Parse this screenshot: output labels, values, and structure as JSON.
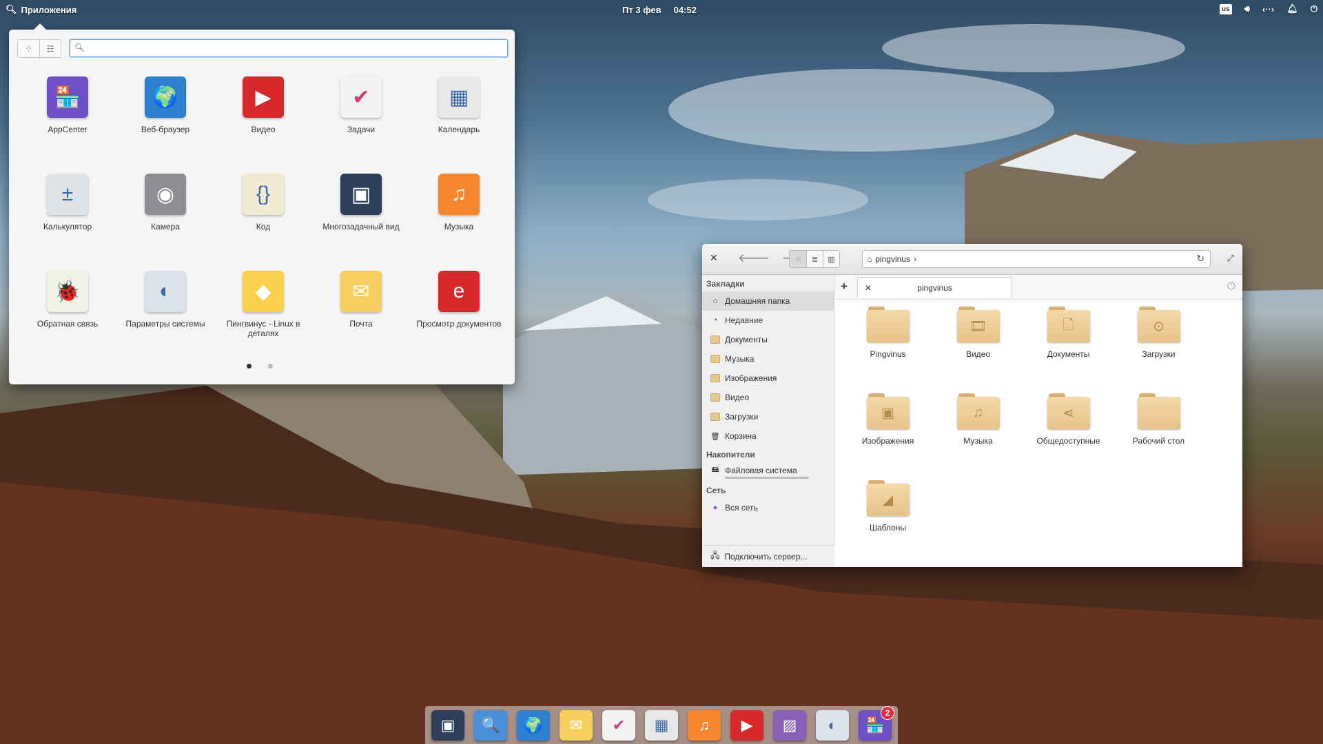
{
  "panel": {
    "apps_label": "Приложения",
    "date": "Пт  3 фев",
    "time": "04:52",
    "keyboard_layout": "us",
    "network": "‹··›"
  },
  "launcher": {
    "search_value": "",
    "apps": [
      {
        "label": "AppCenter",
        "icon": "appcenter-icon",
        "color": "#6f4fc7",
        "glyph": "🏪"
      },
      {
        "label": "Веб-браузер",
        "icon": "browser-icon",
        "color": "#2d7fd0",
        "glyph": "🌍"
      },
      {
        "label": "Видео",
        "icon": "video-icon",
        "color": "#d7282b",
        "glyph": "▶"
      },
      {
        "label": "Задачи",
        "icon": "tasks-icon",
        "color": "#f2f2f2",
        "glyph": "✔"
      },
      {
        "label": "Календарь",
        "icon": "calendar-icon",
        "color": "#e8e8e8",
        "glyph": "▦"
      },
      {
        "label": "Калькулятор",
        "icon": "calculator-icon",
        "color": "#dfe3e6",
        "glyph": "±"
      },
      {
        "label": "Камера",
        "icon": "camera-icon",
        "color": "#8d8f93",
        "glyph": "◉"
      },
      {
        "label": "Код",
        "icon": "code-icon",
        "color": "#f2ebd3",
        "glyph": "{}"
      },
      {
        "label": "Многозадачный вид",
        "icon": "multitasking-icon",
        "color": "#2c3e59",
        "glyph": "▣"
      },
      {
        "label": "Музыка",
        "icon": "music-icon",
        "color": "#f5862d",
        "glyph": "♫"
      },
      {
        "label": "Обратная связь",
        "icon": "feedback-icon",
        "color": "#eef3e6",
        "glyph": "🐞"
      },
      {
        "label": "Параметры системы",
        "icon": "settings-icon",
        "color": "#dde3ea",
        "glyph": "◐"
      },
      {
        "label": "Пингвинус - Linux в деталях",
        "icon": "pingvinus-icon",
        "color": "#fbd04b",
        "glyph": "◆"
      },
      {
        "label": "Почта",
        "icon": "mail-icon",
        "color": "#f6cf5c",
        "glyph": "✉"
      },
      {
        "label": "Просмотр документов",
        "icon": "document-viewer-icon",
        "color": "#d7282b",
        "glyph": "e"
      }
    ],
    "page": 1,
    "pages": 2
  },
  "files": {
    "path": "pingvinus",
    "tab_label": "pingvinus",
    "sections": {
      "bookmarks": "Закладки",
      "devices": "Накопители",
      "network": "Сеть"
    },
    "bookmarks": [
      {
        "label": "Домашняя папка",
        "icon": "home-icon"
      },
      {
        "label": "Недавние",
        "icon": "recent-icon"
      },
      {
        "label": "Документы",
        "icon": "folder-icon"
      },
      {
        "label": "Музыка",
        "icon": "folder-icon"
      },
      {
        "label": "Изображения",
        "icon": "folder-icon"
      },
      {
        "label": "Видео",
        "icon": "folder-icon"
      },
      {
        "label": "Загрузки",
        "icon": "folder-icon"
      },
      {
        "label": "Корзина",
        "icon": "trash-icon"
      }
    ],
    "devices": [
      {
        "label": "Файловая система",
        "icon": "drive-icon"
      }
    ],
    "network_items": [
      {
        "label": "Вся сеть",
        "icon": "network-icon"
      }
    ],
    "connect_label": "Подключить сервер...",
    "folders": [
      {
        "label": "Pingvinus",
        "glyph": ""
      },
      {
        "label": "Видео",
        "glyph": "🎞"
      },
      {
        "label": "Документы",
        "glyph": "🗋"
      },
      {
        "label": "Загрузки",
        "glyph": "⊙"
      },
      {
        "label": "Изображения",
        "glyph": "▣"
      },
      {
        "label": "Музыка",
        "glyph": "♫"
      },
      {
        "label": "Общедоступные",
        "glyph": "⋖"
      },
      {
        "label": "Рабочий стол",
        "glyph": ""
      },
      {
        "label": "Шаблоны",
        "glyph": "◢"
      }
    ]
  },
  "dock": [
    {
      "name": "multitasking-icon",
      "color": "#2c3e59",
      "glyph": "▣"
    },
    {
      "name": "file-manager-icon",
      "color": "#4a8fd9",
      "glyph": "🔍"
    },
    {
      "name": "browser-icon",
      "color": "#2d7fd0",
      "glyph": "🌍"
    },
    {
      "name": "mail-icon",
      "color": "#f6cf5c",
      "glyph": "✉"
    },
    {
      "name": "tasks-icon",
      "color": "#f2f2f2",
      "glyph": "✔"
    },
    {
      "name": "calendar-icon",
      "color": "#e8e8e8",
      "glyph": "▦"
    },
    {
      "name": "music-icon",
      "color": "#f5862d",
      "glyph": "♫"
    },
    {
      "name": "video-icon",
      "color": "#d7282b",
      "glyph": "▶"
    },
    {
      "name": "photos-icon",
      "color": "#8a5fb8",
      "glyph": "▨"
    },
    {
      "name": "settings-icon",
      "color": "#dde3ea",
      "glyph": "◐"
    },
    {
      "name": "appcenter-icon",
      "color": "#6f4fc7",
      "glyph": "🏪",
      "badge": "2"
    }
  ]
}
